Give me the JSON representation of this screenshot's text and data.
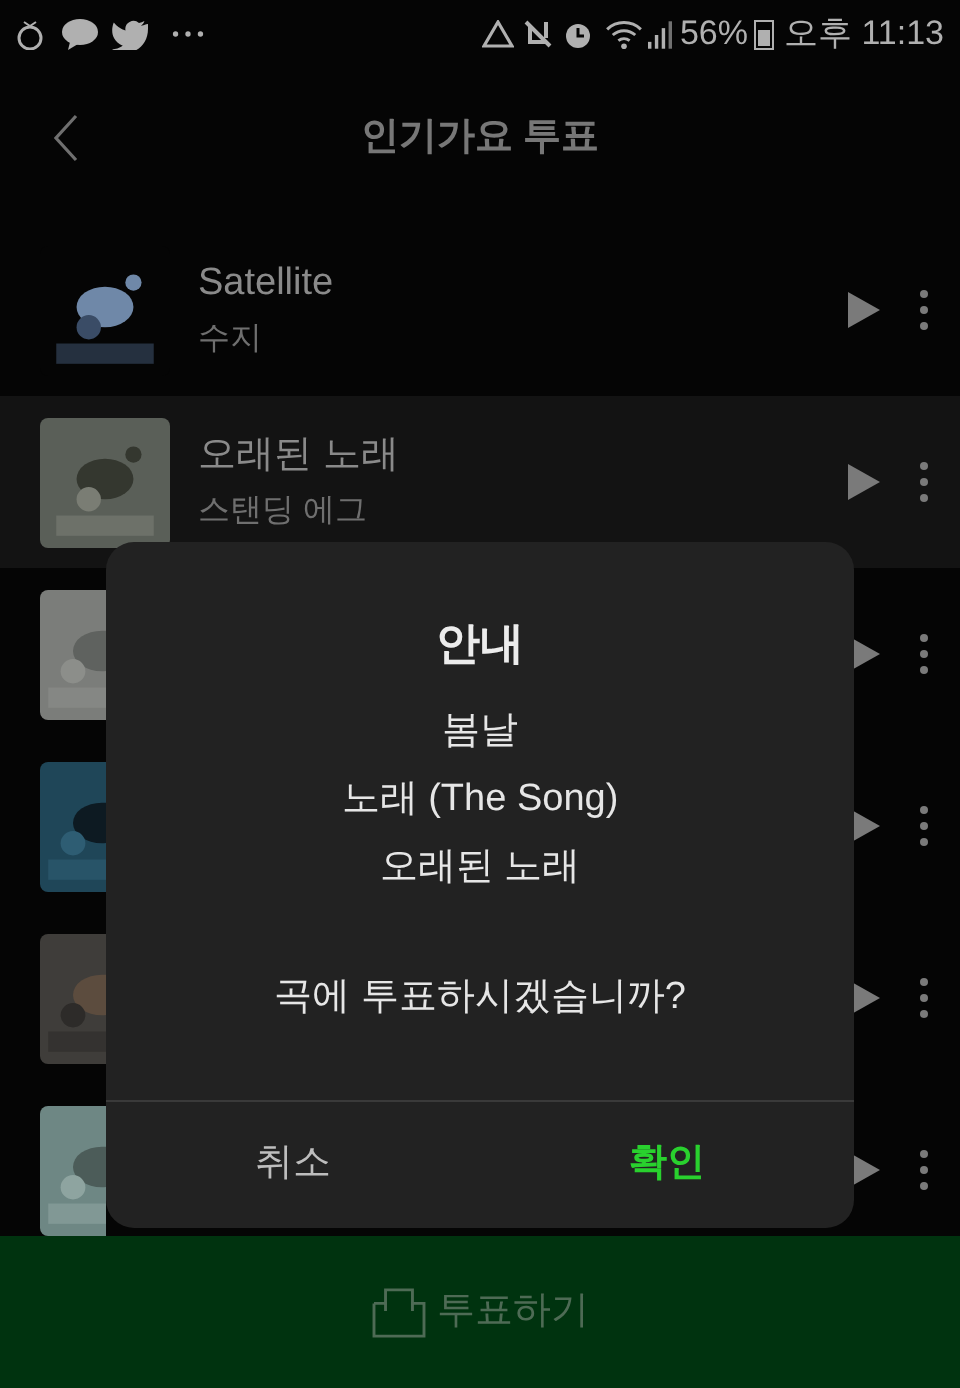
{
  "status_bar": {
    "battery": "56%",
    "time": "오후 11:13"
  },
  "header": {
    "title": "인기가요 투표"
  },
  "songs": [
    {
      "title": "Satellite",
      "artist": "수지",
      "selected": false
    },
    {
      "title": "오래된 노래",
      "artist": "스탠딩 에그",
      "selected": true
    },
    {
      "selected": false
    },
    {
      "selected": false
    },
    {
      "selected": false
    },
    {
      "selected": false
    }
  ],
  "dialog": {
    "title": "안내",
    "songs": [
      "봄날",
      "노래 (The Song)",
      "오래된 노래"
    ],
    "question": "곡에 투표하시겠습니까?",
    "buttons": [
      {
        "label": "취소",
        "kind": "cancel"
      },
      {
        "label": "확인",
        "kind": "confirm"
      }
    ]
  },
  "vote_bar": {
    "label": "투표하기"
  }
}
